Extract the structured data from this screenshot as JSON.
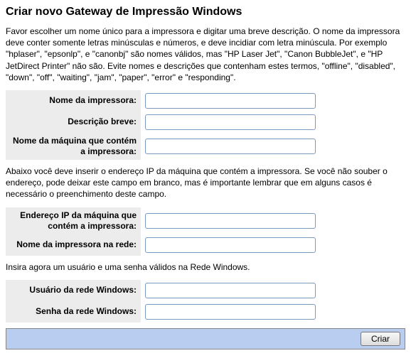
{
  "title": "Criar novo Gateway de Impressão Windows",
  "intro": "Favor escolher um nome único para a impressora e digitar uma breve descrição. O nome da impressora deve conter somente letras minúsculas e números, e deve incidiar com letra minúscula. Por exemplo \"hplaser\", \"epsonlp\", e \"canonbj\" são nomes válidos, mas \"HP Laser Jet\", \"Canon BubbleJet\", e \"HP JetDirect Printer\" não são. Evite nomes e descrições que contenham estes termos, \"offline\", \"disabled\", \"down\", \"off\", \"waiting\", \"jam\", \"paper\", \"error\" e \"responding\".",
  "block1": {
    "printer_name_label": "Nome da impressora:",
    "short_desc_label": "Descrição breve:",
    "host_name_label": "Nome da máquina que contém a impressora:"
  },
  "mid_text": "Abaixo você deve inserir o endereço IP da máquina que contém a impressora. Se você não souber o endereço, pode deixar este campo em branco, mas é importante lembrar que em alguns casos é necessário o preenchimento deste campo.",
  "block2": {
    "host_ip_label": "Endereço IP da máquina que contém a impressora:",
    "net_printer_name_label": "Nome da impressora na rede:"
  },
  "cred_text": "Insira agora um usuário e uma senha válidos na Rede Windows.",
  "block3": {
    "win_user_label": "Usuário da rede Windows:",
    "win_pass_label": "Senha da rede Windows:"
  },
  "actions": {
    "create_label": "Criar"
  },
  "values": {
    "printer_name": "",
    "short_desc": "",
    "host_name": "",
    "host_ip": "",
    "net_printer_name": "",
    "win_user": "",
    "win_pass": ""
  }
}
